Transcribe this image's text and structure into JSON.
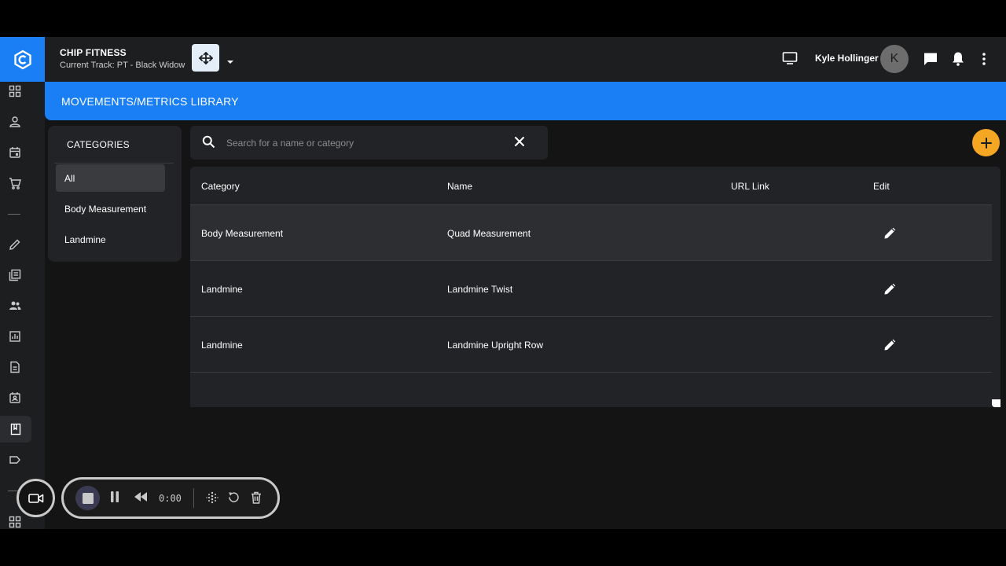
{
  "app": {
    "brand_name": "CHIP FITNESS",
    "current_track": "Current Track: PT - Black Widow"
  },
  "header": {
    "user_name": "Kyle Hollinger",
    "avatar_initial": "K"
  },
  "page": {
    "title": "MOVEMENTS/METRICS LIBRARY"
  },
  "categories": {
    "header": "CATEGORIES",
    "items": [
      {
        "label": "All",
        "selected": true
      },
      {
        "label": "Body Measurement",
        "selected": false
      },
      {
        "label": "Landmine",
        "selected": false
      }
    ]
  },
  "search": {
    "placeholder": "Search for a name or category",
    "value": ""
  },
  "table": {
    "columns": [
      "Category",
      "Name",
      "URL Link",
      "Edit"
    ],
    "rows": [
      {
        "category": "Body Measurement",
        "name": "Quad Measurement",
        "url": ""
      },
      {
        "category": "Landmine",
        "name": "Landmine Twist",
        "url": ""
      },
      {
        "category": "Landmine",
        "name": "Landmine Upright Row",
        "url": ""
      }
    ]
  },
  "recorder": {
    "time": "0:00"
  },
  "colors": {
    "primary": "#1a7ef5",
    "accent": "#f5a623",
    "background": "#141415",
    "surface": "#222326"
  },
  "icons": {
    "sidebar": [
      "dashboard-icon",
      "person-icon",
      "calendar-icon",
      "cart-icon",
      "pencil-icon",
      "library-books-icon",
      "group-icon",
      "analytics-icon",
      "document-icon",
      "contact-calendar-icon",
      "book-icon",
      "label-icon",
      "dashboard-icon"
    ]
  }
}
